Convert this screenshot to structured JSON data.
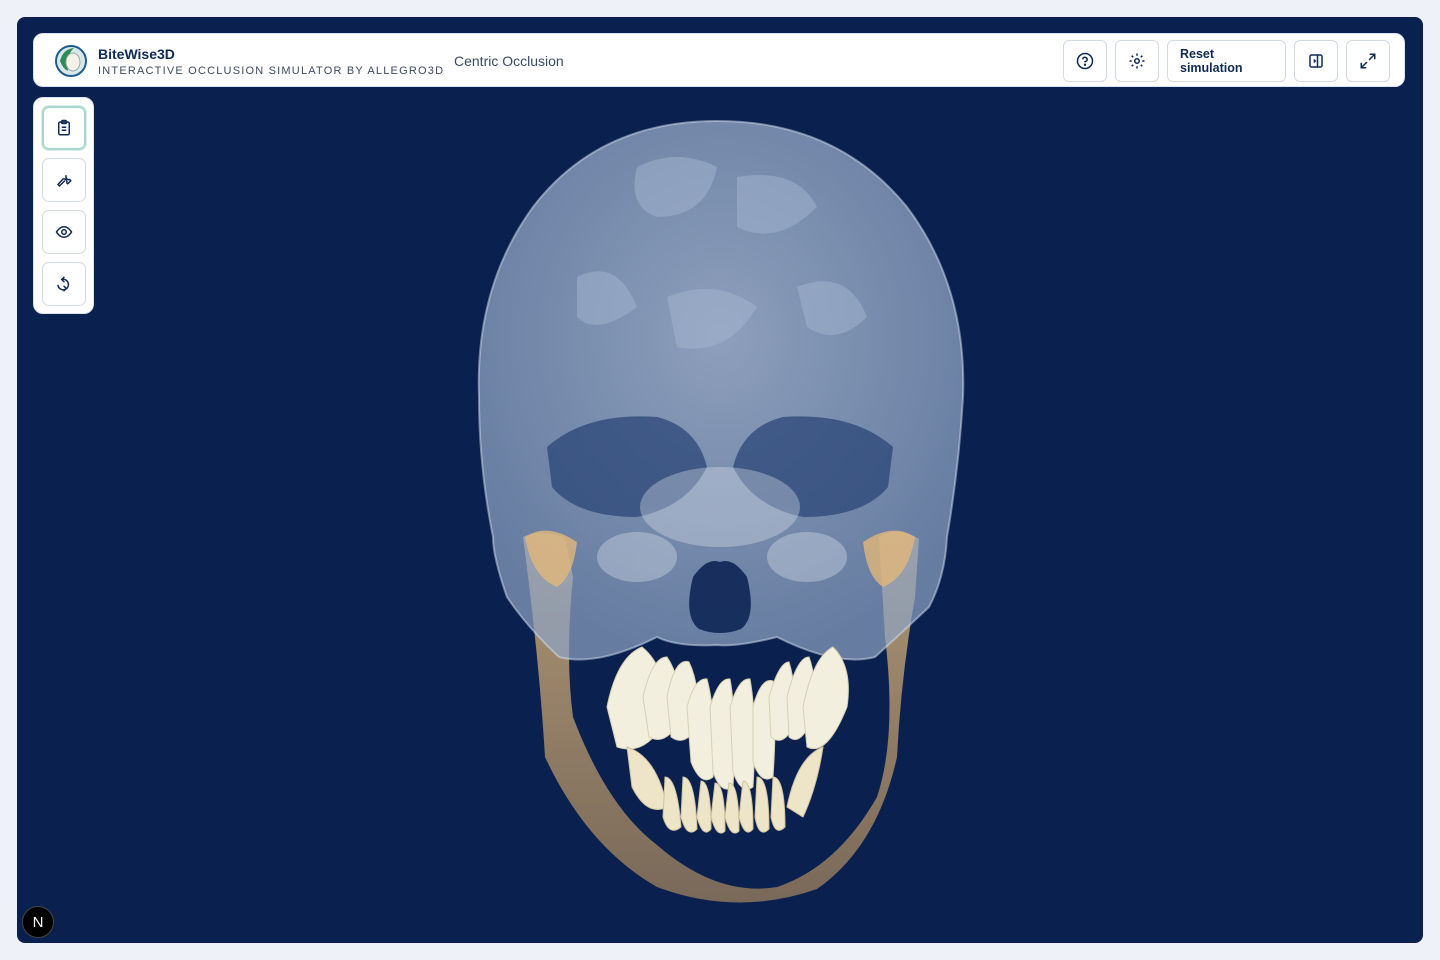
{
  "app": {
    "name": "BiteWise3D",
    "subtitle": "INTERACTIVE OCCLUSION SIMULATOR BY ALLEGRO3D",
    "mode": "Centric Occlusion"
  },
  "header_actions": {
    "help_icon": "help-circle-icon",
    "settings_icon": "gear-icon",
    "reset_label": "Reset simulation",
    "panel_icon": "side-panel-icon",
    "fullscreen_icon": "expand-icon"
  },
  "toolbar": {
    "items": [
      {
        "icon": "clipboard-icon",
        "active": true
      },
      {
        "icon": "wrench-icon",
        "active": false
      },
      {
        "icon": "eye-icon",
        "active": false
      },
      {
        "icon": "rotate-icon",
        "active": false
      }
    ]
  },
  "badge": {
    "letter": "N"
  },
  "colors": {
    "viewport_bg": "#0a2150",
    "skull": "#c6d4e6",
    "jaw": "#d6b07a",
    "teeth": "#f2eedc",
    "accent": "#a9d8cf"
  }
}
